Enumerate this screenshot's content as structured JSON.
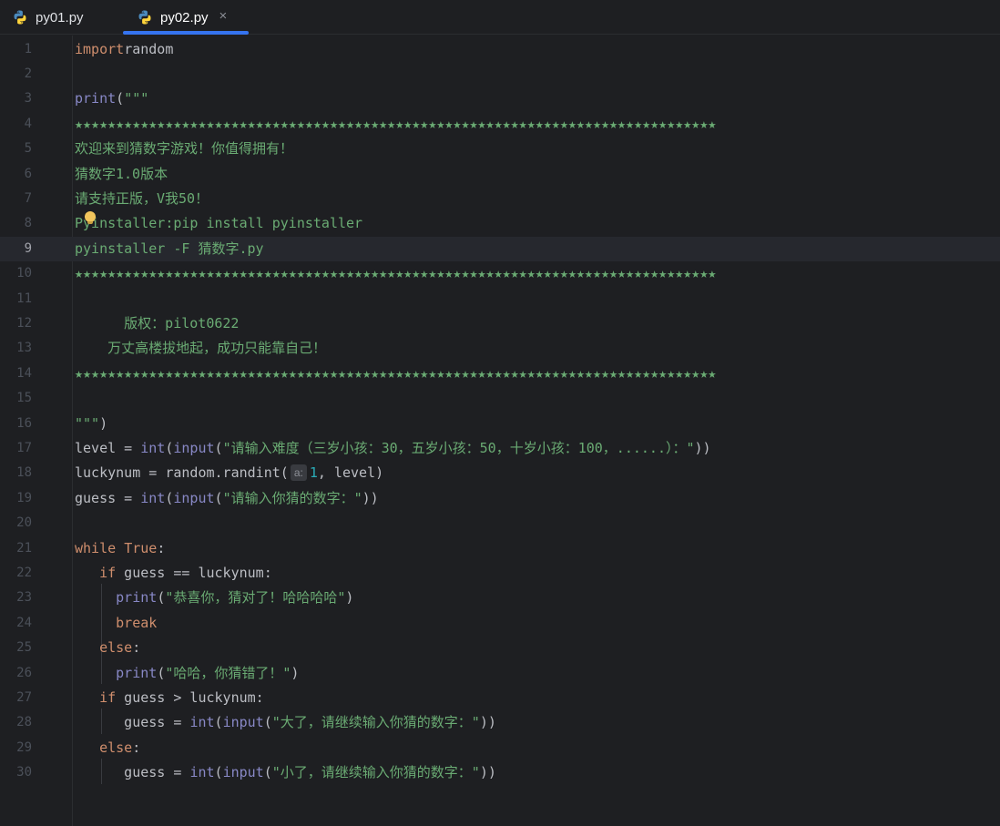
{
  "tabs": [
    {
      "label": "py01.py",
      "icon": "python-file-icon",
      "active": false
    },
    {
      "label": "py02.py",
      "icon": "python-file-icon",
      "active": true,
      "close": "×"
    }
  ],
  "colors": {
    "background": "#1e1f22",
    "keyword": "#cf8e6d",
    "builtin": "#8888c6",
    "string": "#6aab73",
    "number": "#2aacb8",
    "text": "#bcbec4",
    "active_tab_underline": "#3574f0"
  },
  "editor": {
    "current_line": 9,
    "lines": [
      {
        "n": "1",
        "tokens": [
          [
            "kw",
            "import"
          ],
          [
            "",
            "random"
          ]
        ]
      },
      {
        "n": "2",
        "tokens": []
      },
      {
        "n": "3",
        "tokens": [
          [
            "bi",
            "print"
          ],
          [
            "",
            "("
          ],
          [
            "st",
            "\"\"\""
          ]
        ]
      },
      {
        "n": "4",
        "tokens": [
          [
            "st",
            "★★★★★★★★★★★★★★★★★★★★★★★★★★★★★★★★★★★★★★★★★★★★★★★★★★★★★★★★★★★★★★★★★★★★★★★★★★★★★★"
          ]
        ]
      },
      {
        "n": "5",
        "tokens": [
          [
            "st",
            "欢迎来到猜数字游戏！你值得拥有！"
          ]
        ]
      },
      {
        "n": "6",
        "tokens": [
          [
            "st",
            "猜数字1.0版本"
          ]
        ]
      },
      {
        "n": "7",
        "tokens": [
          [
            "st",
            "请支持正版，V我50！"
          ]
        ]
      },
      {
        "n": "8",
        "tokens": [
          [
            "st",
            "Pyinstaller:pip install pyinstaller"
          ]
        ]
      },
      {
        "n": "9",
        "tokens": [
          [
            "st",
            "pyinstaller -F 猜数字.py"
          ]
        ]
      },
      {
        "n": "10",
        "tokens": [
          [
            "st",
            "★★★★★★★★★★★★★★★★★★★★★★★★★★★★★★★★★★★★★★★★★★★★★★★★★★★★★★★★★★★★★★★★★★★★★★★★★★★★★★"
          ]
        ]
      },
      {
        "n": "11",
        "tokens": []
      },
      {
        "n": "12",
        "tokens": [
          [
            "st",
            "      版权：pilot0622"
          ]
        ]
      },
      {
        "n": "13",
        "tokens": [
          [
            "st",
            "    万丈高楼拔地起，成功只能靠自己！"
          ]
        ]
      },
      {
        "n": "14",
        "tokens": [
          [
            "st",
            "★★★★★★★★★★★★★★★★★★★★★★★★★★★★★★★★★★★★★★★★★★★★★★★★★★★★★★★★★★★★★★★★★★★★★★★★★★★★★★"
          ]
        ]
      },
      {
        "n": "15",
        "tokens": []
      },
      {
        "n": "16",
        "tokens": [
          [
            "st",
            "\"\"\""
          ],
          [
            "",
            ")"
          ]
        ]
      },
      {
        "n": "17",
        "tokens": [
          [
            "",
            "level = "
          ],
          [
            "bi",
            "int"
          ],
          [
            "",
            "("
          ],
          [
            "bi",
            "input"
          ],
          [
            "",
            "("
          ],
          [
            "st",
            "\"请输入难度（三岁小孩：30，五岁小孩：50，十岁小孩：100，......）：\""
          ],
          [
            "",
            "))"
          ]
        ]
      },
      {
        "n": "18",
        "tokens": [
          [
            "",
            "luckynum = random.randint("
          ],
          [
            "hint",
            "a:"
          ],
          [
            "num",
            "1"
          ],
          [
            "",
            ", level)"
          ]
        ]
      },
      {
        "n": "19",
        "tokens": [
          [
            "",
            "guess = "
          ],
          [
            "bi",
            "int"
          ],
          [
            "",
            "("
          ],
          [
            "bi",
            "input"
          ],
          [
            "",
            "("
          ],
          [
            "st",
            "\"请输入你猜的数字：\""
          ],
          [
            "",
            "))"
          ]
        ]
      },
      {
        "n": "20",
        "tokens": []
      },
      {
        "n": "21",
        "tokens": [
          [
            "kw",
            "while"
          ],
          [
            "",
            " "
          ],
          [
            "kw",
            "True"
          ],
          [
            "",
            ":"
          ]
        ]
      },
      {
        "n": "22",
        "tokens": [
          [
            "",
            "   "
          ],
          [
            "kw",
            "if"
          ],
          [
            "",
            " guess == luckynum:"
          ]
        ]
      },
      {
        "n": "23",
        "tokens": [
          [
            "",
            "     "
          ],
          [
            "bi",
            "print"
          ],
          [
            "",
            "("
          ],
          [
            "st",
            "\"恭喜你，猜对了！哈哈哈哈\""
          ],
          [
            "",
            ")"
          ]
        ]
      },
      {
        "n": "24",
        "tokens": [
          [
            "",
            "     "
          ],
          [
            "kw",
            "break"
          ]
        ]
      },
      {
        "n": "25",
        "tokens": [
          [
            "",
            "   "
          ],
          [
            "kw",
            "else"
          ],
          [
            "",
            ":"
          ]
        ]
      },
      {
        "n": "26",
        "tokens": [
          [
            "",
            "     "
          ],
          [
            "bi",
            "print"
          ],
          [
            "",
            "("
          ],
          [
            "st",
            "\"哈哈，你猜错了！\""
          ],
          [
            "",
            ")"
          ]
        ]
      },
      {
        "n": "27",
        "tokens": [
          [
            "",
            "   "
          ],
          [
            "kw",
            "if"
          ],
          [
            "",
            " guess > luckynum:"
          ]
        ]
      },
      {
        "n": "28",
        "tokens": [
          [
            "",
            "      guess = "
          ],
          [
            "bi",
            "int"
          ],
          [
            "",
            "("
          ],
          [
            "bi",
            "input"
          ],
          [
            "",
            "("
          ],
          [
            "st",
            "\"大了，请继续输入你猜的数字：\""
          ],
          [
            "",
            "))"
          ]
        ]
      },
      {
        "n": "29",
        "tokens": [
          [
            "",
            "   "
          ],
          [
            "kw",
            "else"
          ],
          [
            "",
            ":"
          ]
        ]
      },
      {
        "n": "30",
        "tokens": [
          [
            "",
            "      guess = "
          ],
          [
            "bi",
            "int"
          ],
          [
            "",
            "("
          ],
          [
            "bi",
            "input"
          ],
          [
            "",
            "("
          ],
          [
            "st",
            "\"小了，请继续输入你猜的数字：\""
          ],
          [
            "",
            "))"
          ]
        ]
      }
    ]
  }
}
